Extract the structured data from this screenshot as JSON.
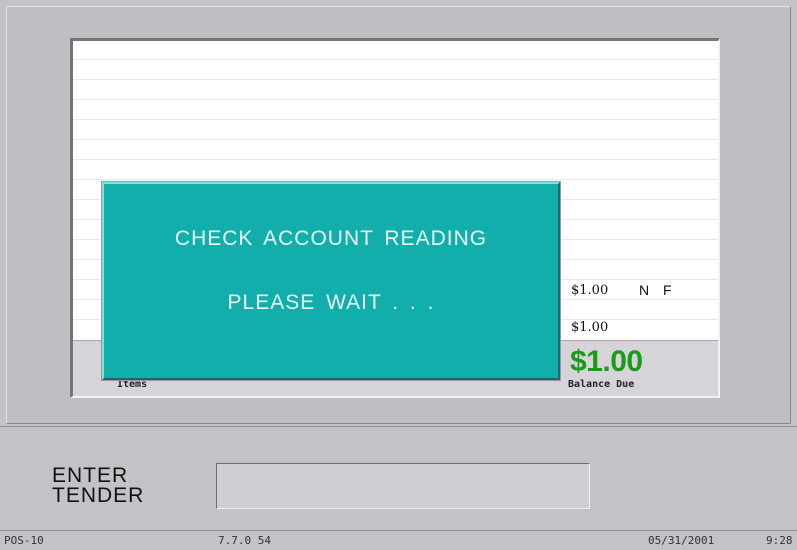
{
  "receipt": {
    "lines": [
      {
        "amount": "$1.00",
        "flag": "N F"
      },
      {
        "amount": "$1.00",
        "flag": ""
      }
    ],
    "items_label": "Items",
    "balance_due_amount": "$1.00",
    "balance_due_label": "Balance Due"
  },
  "dialog": {
    "line1": "CHECK ACCOUNT READING",
    "line2": "PLEASE WAIT . . ."
  },
  "prompt": {
    "line1": "ENTER",
    "line2": "TENDER",
    "input_value": ""
  },
  "status_bar": {
    "terminal": "POS-10",
    "version": "7.7.0 54",
    "date": "05/31/2001",
    "time": "9:28"
  },
  "colors": {
    "dialog_bg": "#12aeac",
    "balance_green": "#1a9a1a"
  }
}
